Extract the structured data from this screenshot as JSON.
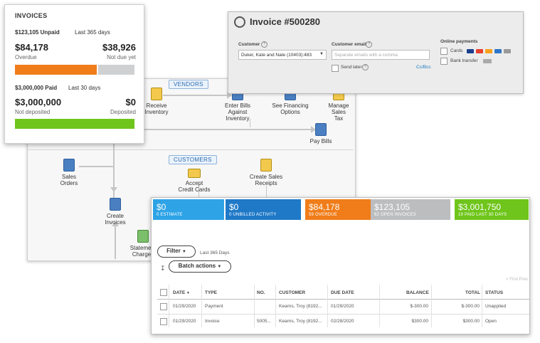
{
  "workflow": {
    "vendors_label": "VENDORS",
    "customers_label": "CUSTOMERS",
    "nodes": {
      "receive_inventory": "Receive\nInventory",
      "enter_bills": "Enter Bills\nAgainst\nInventory",
      "see_financing": "See Financing\nOptions",
      "manage_sales_tax": "Manage\nSales\nTax",
      "pay_bills": "Pay Bills",
      "sales_orders": "Sales\nOrders",
      "accept_cards": "Accept\nCredit Cards",
      "create_receipts": "Create Sales\nReceipts",
      "create_invoices": "Create\nInvoices",
      "statement_charges": "Statement\nCharges"
    }
  },
  "invoice_form": {
    "title": "Invoice #500280",
    "customer_label": "Customer",
    "customer_value": "Duker, Kate and Nate (10403):483",
    "email_label": "Customer email",
    "email_placeholder": "Separate emails with a comma",
    "send_later": "Send later",
    "cc_bcc": "Cc/Bcc",
    "online_payments_label": "Online payments",
    "cards_label": "Cards",
    "bank_label": "Bank transfer"
  },
  "summary": {
    "title": "INVOICES",
    "unpaid_line": "$123,105 Unpaid",
    "unpaid_period": "Last 365 days",
    "overdue_amount": "$84,178",
    "overdue_label": "Overdue",
    "notdue_amount": "$38,926",
    "notdue_label": "Not due yet",
    "paid_line": "$3,000,000 Paid",
    "paid_period": "Last 30 days",
    "notdeposited_amount": "$3,000,000",
    "notdeposited_label": "Not deposited",
    "deposited_amount": "$0",
    "deposited_label": "Deposited",
    "overdue_fraction": 0.684
  },
  "list": {
    "tiles": [
      {
        "value": "$0",
        "caption": "0 ESTIMATE",
        "color": "#2ea3e6"
      },
      {
        "value": "$0",
        "caption": "0 UNBILLED ACTIVITY",
        "color": "#1f79c7"
      },
      {
        "value": "$84,178",
        "caption": "59 OVERDUE",
        "color": "#f07d1a"
      },
      {
        "value": "$123,105",
        "caption": "62 OPEN INVOICES",
        "color": "#bcbdbf"
      },
      {
        "value": "$3,001,750",
        "caption": "19 PAID LAST 30 DAYS",
        "color": "#6fc51b"
      }
    ],
    "filter_label": "Filter",
    "filter_period": "Last 365 Days",
    "batch_label": "Batch actions",
    "pager": "< First   Prev",
    "columns": [
      "DATE",
      "TYPE",
      "NO.",
      "CUSTOMER",
      "DUE DATE",
      "BALANCE",
      "TOTAL",
      "STATUS"
    ],
    "rows": [
      [
        "01/29/2020",
        "Payment",
        "",
        "Kearns, Troy (8192...",
        "01/29/2020",
        "$-300.00",
        "$-300.00",
        "Unapplied"
      ],
      [
        "01/29/2020",
        "Invoice",
        "5005...",
        "Kearns, Troy (8192...",
        "02/28/2020",
        "$300.00",
        "$300.00",
        "Open"
      ]
    ]
  }
}
